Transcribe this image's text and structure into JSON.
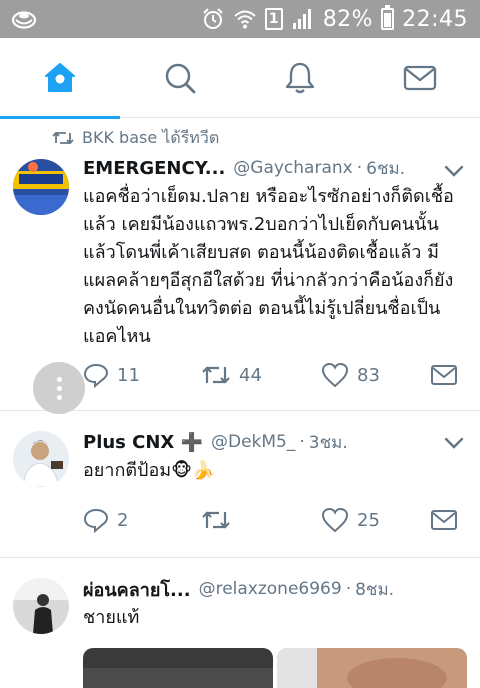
{
  "status_bar": {
    "battery_percent": "82%",
    "time": "22:45",
    "sim_slot": "1",
    "icons": [
      "app-notification-icon",
      "alarm-icon",
      "wifi-icon",
      "sim-icon",
      "signal-icon",
      "battery-icon"
    ]
  },
  "tabs": [
    {
      "name": "home",
      "icon": "home-icon",
      "active": true
    },
    {
      "name": "search",
      "icon": "search-icon",
      "active": false
    },
    {
      "name": "notifications",
      "icon": "bell-icon",
      "active": false
    },
    {
      "name": "messages",
      "icon": "mail-icon",
      "active": false
    }
  ],
  "colors": {
    "accent": "#1da1f2",
    "text_primary": "#14171a",
    "text_secondary": "#657786",
    "status_bar": "#9e9e9e"
  },
  "tweets": [
    {
      "retweeted_by": "BKK base ได้รีทวีต",
      "name": "EMERGENCY...",
      "handle": "@Gaycharanx",
      "time": "6ชม.",
      "text": "แอคชื่อว่าเย็ดม.ปลาย หรืออะไรซักอย่างก็ติดเชื้อแล้ว เคยมีน้องแถวพร.2บอกว่าไปเย็ดกับคนนั้น แล้วโดนพี่เค้าเสียบสด ตอนนี้น้องติดเชื้อแล้ว มีแผลคล้ายๆอีสุกอีใสด้วย ที่น่ากลัวกว่าคือน้องก็ยังคงนัดคนอื่นในทวิตต่อ ตอนนี้ไม่รู้เปลี่ยนชื่อเป็นแอคไหน",
      "replies": "11",
      "retweets": "44",
      "likes": "83"
    },
    {
      "name": "Plus CNX ➕",
      "handle": "@DekM5_",
      "time": "3ชม.",
      "text": "อยากตีป้อม🐵🍌",
      "replies": "2",
      "retweets": "",
      "likes": "25"
    },
    {
      "name": "ผ่อนคลายโ...",
      "handle": "@relaxzone6969",
      "time": "8ชม.",
      "text": "ชายแท้"
    }
  ]
}
